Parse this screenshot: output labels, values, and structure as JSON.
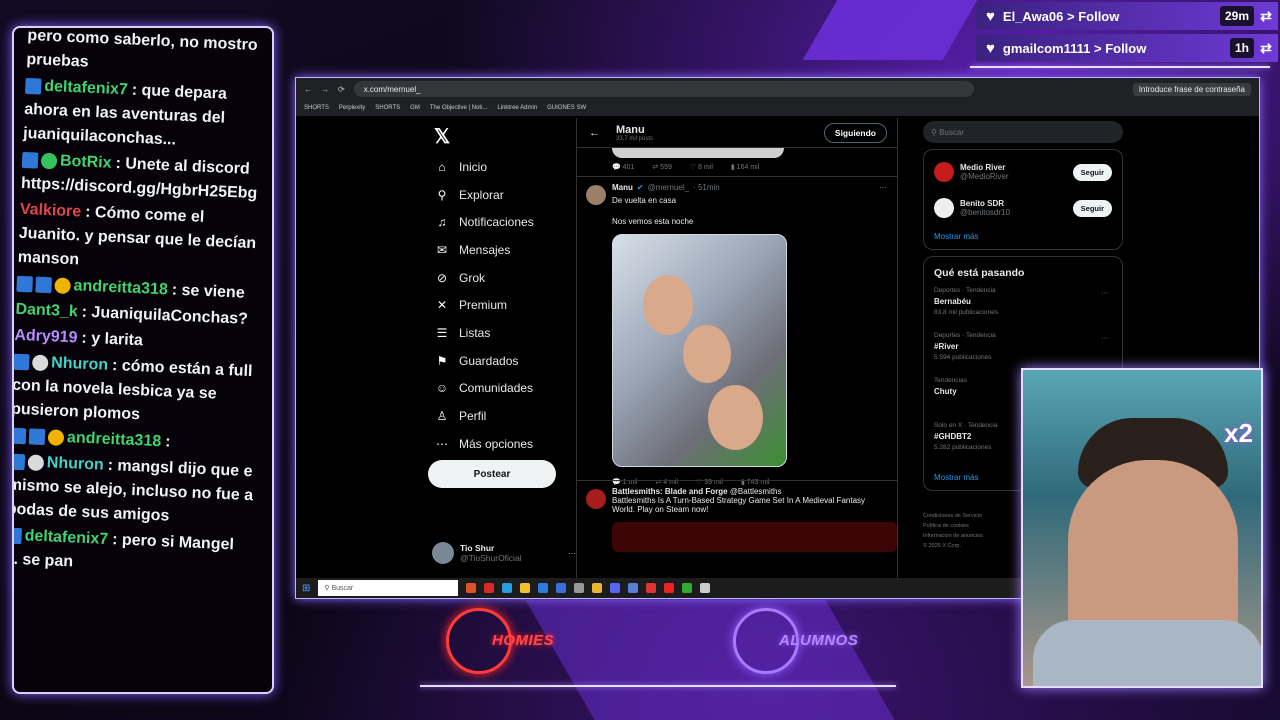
{
  "chat": {
    "messages": [
      {
        "name": "",
        "text": "pero como saberlo, no mostro pruebas",
        "color": "#f2f2f2",
        "badges": []
      },
      {
        "name": "deltafenix7",
        "text": ": que depara ahora en las aventuras del juaniquilaconchas...",
        "color": "#41d36c",
        "badges": [
          "blue"
        ]
      },
      {
        "name": "BotRix",
        "text": ": Unete al discord https://discord.gg/HgbrH25Ebg",
        "color": "#41d36c",
        "badges": [
          "blue",
          "green"
        ]
      },
      {
        "name": "Valkiore",
        "text": ": Cómo come el Juanito. y pensar que le decían manson",
        "color": "#e0474c",
        "badges": []
      },
      {
        "name": "andreitta318",
        "text": ": se viene",
        "color": "#41d36c",
        "badges": [
          "blue",
          "blue",
          "yellow"
        ]
      },
      {
        "name": "Dant3_k",
        "text": ": JuaniquilaConchas?",
        "color": "#41d36c",
        "badges": []
      },
      {
        "name": "Adry919",
        "text": ": y larita",
        "color": "#b78cff",
        "badges": []
      },
      {
        "name": "Nhuron",
        "text": ": cómo están a full con la novela lesbica ya se pusieron plomos",
        "color": "#41d3c8",
        "badges": [
          "blue",
          "white"
        ]
      },
      {
        "name": "andreitta318",
        "text": ":",
        "color": "#41d36c",
        "badges": [
          "blue",
          "blue",
          "yellow"
        ]
      },
      {
        "name": "Nhuron",
        "text": ": mangsl dijo que e mismo se alejo, incluso no fue a bodas de sus amigos",
        "color": "#41d3c8",
        "badges": [
          "blue",
          "white"
        ]
      },
      {
        "name": "deltafenix7",
        "text": ": pero si Mangel ... se pan",
        "color": "#41d36c",
        "badges": [
          "blue"
        ]
      }
    ]
  },
  "alerts": [
    {
      "user": "El_Awa06",
      "action": "> Follow",
      "time": "29m"
    },
    {
      "user": "gmailcom1111",
      "action": "> Follow",
      "time": "1h"
    }
  ],
  "browser": {
    "url": "x.com/mernuel_",
    "password_hint": "Introduce frase de contraseña",
    "bookmarks": [
      "SHORTS",
      "Perplexity",
      "SHORTS",
      "GM",
      "The Objective | Noti...",
      "Linktree Admin",
      "GUIONES SW"
    ]
  },
  "nav": {
    "items": [
      {
        "label": "Inicio",
        "icon": "home-icon",
        "glyph": "⌂"
      },
      {
        "label": "Explorar",
        "icon": "search-icon",
        "glyph": "⚲"
      },
      {
        "label": "Notificaciones",
        "icon": "bell-icon",
        "glyph": "♫"
      },
      {
        "label": "Mensajes",
        "icon": "mail-icon",
        "glyph": "✉"
      },
      {
        "label": "Grok",
        "icon": "grok-icon",
        "glyph": "⊘"
      },
      {
        "label": "Premium",
        "icon": "x-icon",
        "glyph": "✕"
      },
      {
        "label": "Listas",
        "icon": "list-icon",
        "glyph": "☰"
      },
      {
        "label": "Guardados",
        "icon": "bookmark-icon",
        "glyph": "⚑"
      },
      {
        "label": "Comunidades",
        "icon": "people-icon",
        "glyph": "☺"
      },
      {
        "label": "Perfil",
        "icon": "person-icon",
        "glyph": "♙"
      },
      {
        "label": "Más opciones",
        "icon": "more-icon",
        "glyph": "⋯"
      }
    ],
    "post_label": "Postear",
    "me_name": "Tio Shur",
    "me_handle": "@TioShurOficial"
  },
  "timeline": {
    "title": "Manu",
    "posts_count": "33,7 mil posts",
    "follow_label": "Siguiendo",
    "prev_actions": {
      "replies": "401",
      "reposts": "559",
      "likes": "8 mil",
      "views": "164 mil"
    },
    "tweet": {
      "name": "Manu",
      "handle": "@mernuel_",
      "time": "· 51min",
      "line1": "De vuelta en casa",
      "line2": "Nos vemos esta noche",
      "actions": {
        "replies": "1 mil",
        "reposts": "4 mil",
        "likes": "39 mil",
        "views": "743 mil"
      }
    },
    "ad": {
      "name": "Battlesmiths: Blade and Forge",
      "handle": "@Battlesmiths",
      "text": "Battlesmiths Is A Turn-Based Strategy Game Set In A Medieval Fantasy World. Play on Steam now!"
    }
  },
  "right": {
    "search_placeholder": "Buscar",
    "who": [
      {
        "name": "Medio River",
        "handle": "@MedioRiver",
        "button": "Seguir"
      },
      {
        "name": "Benito SDR",
        "handle": "@benitosdr10",
        "button": "Seguir"
      }
    ],
    "show_more": "Mostrar más",
    "trending_title": "Qué está pasando",
    "trends": [
      {
        "context": "Deportes · Tendencia",
        "topic": "Bernabéu",
        "posts": "83,8 mil publicaciones"
      },
      {
        "context": "Deportes · Tendencia",
        "topic": "#River",
        "posts": "5.594 publicaciones"
      },
      {
        "context": "Tendencias",
        "topic": "Chuty",
        "posts": ""
      },
      {
        "context": "Solo en X · Tendencia",
        "topic": "#GHDBT2",
        "posts": "5.282 publicaciones"
      }
    ],
    "show_more_2": "Mostrar más",
    "footer": [
      "Condiciones de Servicio",
      "Política de cookies",
      "Información de anuncios",
      "© 2025 X Corp."
    ]
  },
  "taskbar": {
    "search_placeholder": "Buscar"
  },
  "overlay": {
    "homies": "HOMIES",
    "alumnos": "ALUMNOS",
    "multiplier": "x2"
  }
}
